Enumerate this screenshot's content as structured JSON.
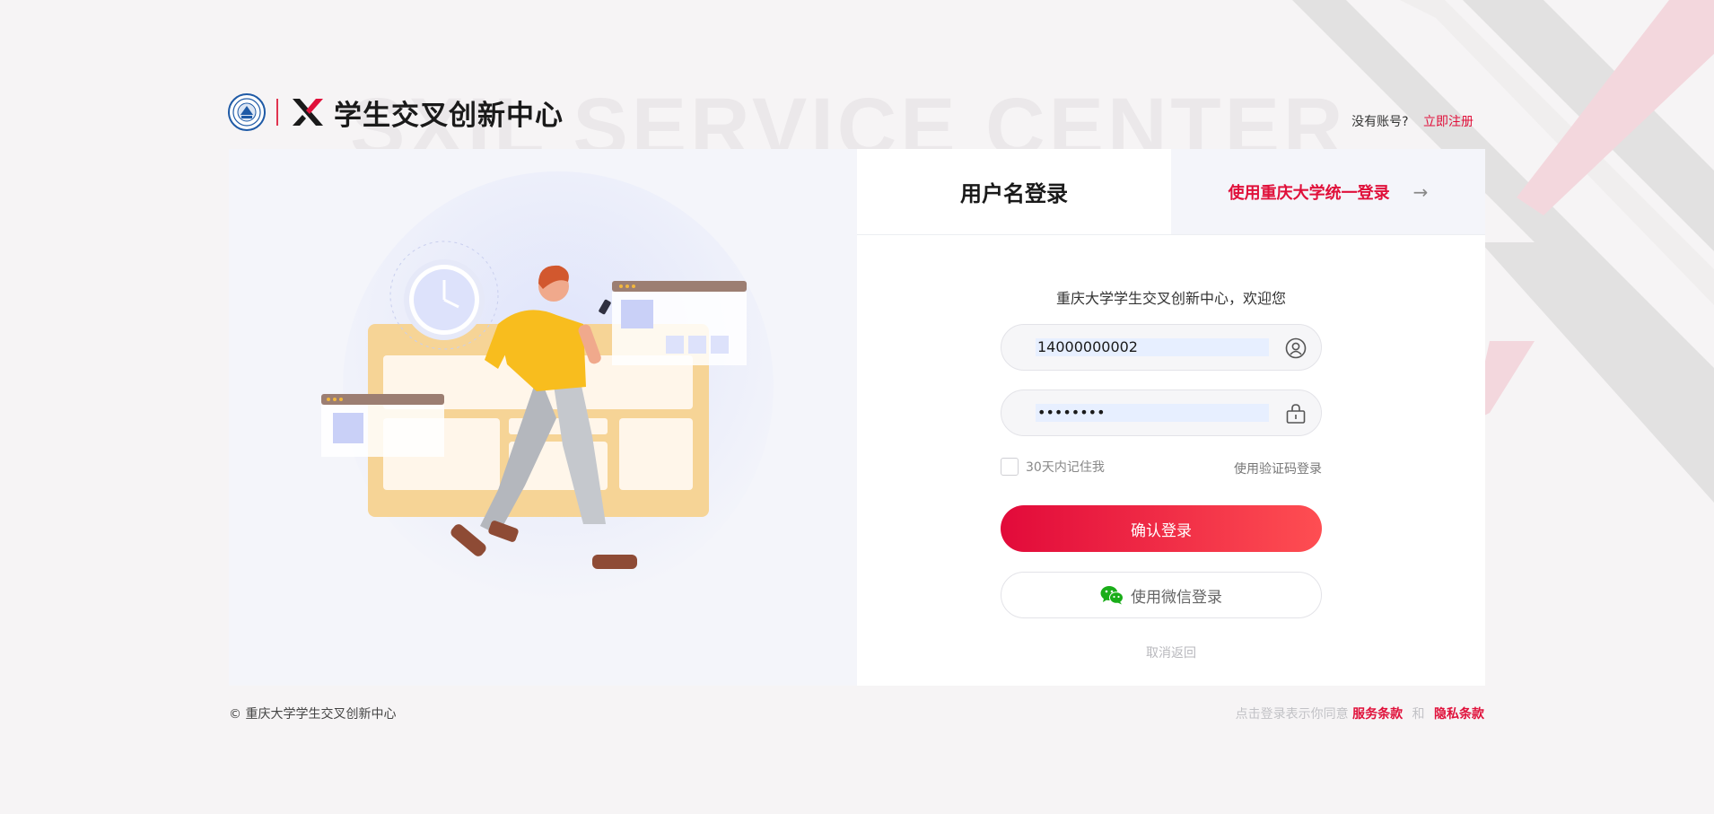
{
  "watermark": "SXIL SERVICE CENTER",
  "header": {
    "brand_title": "学生交叉创新中心",
    "no_account": "没有账号?",
    "register_link": "立即注册"
  },
  "tabs": {
    "username_login": "用户名登录",
    "sso_login": "使用重庆大学统一登录",
    "sso_arrow": "→"
  },
  "form": {
    "welcome": "重庆大学学生交叉创新中心，欢迎您",
    "username_value": "14000000002",
    "password_value": "••••••••",
    "remember_label": "30天内记住我",
    "sms_login": "使用验证码登录",
    "submit_label": "确认登录",
    "wechat_label": "使用微信登录",
    "cancel_label": "取消返回"
  },
  "footer": {
    "copyright": "© 重庆大学学生交叉创新中心",
    "agree_text": "点击登录表示你同意",
    "service_terms": "服务条款",
    "and": "和",
    "privacy_terms": "隐私条款"
  },
  "colors": {
    "accent": "#e0103a",
    "button_gradient_start": "#e20a3a",
    "button_gradient_end": "#fe4e52",
    "wechat_green": "#1aad19"
  },
  "icons": [
    "university-seal-icon",
    "x-logo-icon",
    "user-icon",
    "lock-icon",
    "arrow-right-icon",
    "wechat-icon"
  ]
}
